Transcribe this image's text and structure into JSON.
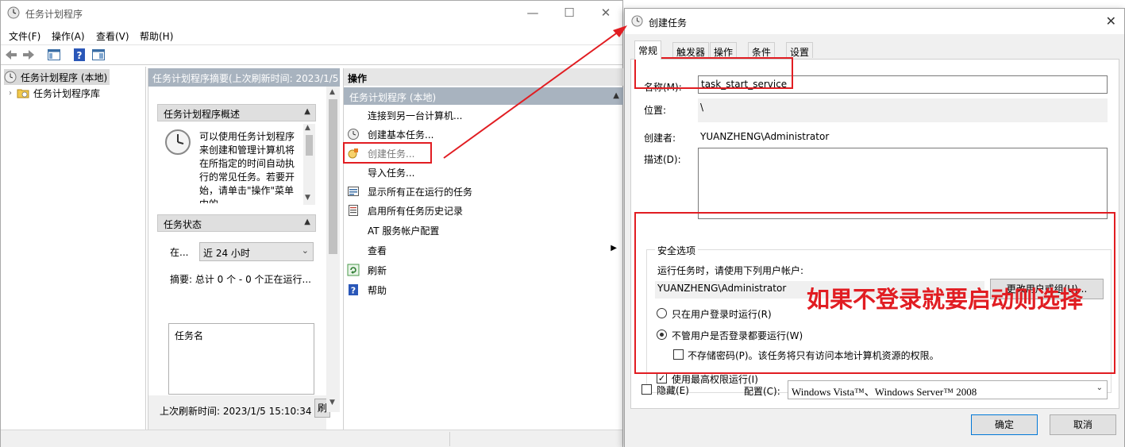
{
  "main_window": {
    "title": "任务计划程序",
    "menu": [
      "文件(F)",
      "操作(A)",
      "查看(V)",
      "帮助(H)"
    ],
    "tree": [
      "任务计划程序 (本地)",
      "任务计划程序库"
    ],
    "center": {
      "header": "任务计划程序摘要(上次刷新时间: 2023/1/5",
      "overview_title": "任务计划程序概述",
      "overview_text": "可以使用任务计划程序来创建和管理计算机将在所指定的时间自动执行的常见任务。若要开始，请单击\"操作\"菜单中的",
      "status_title": "任务状态",
      "status_prefix": "在...",
      "status_select": "近 24 小时",
      "summary": "摘要: 总计 0 个 - 0 个正在运行...",
      "task_col": "任务名",
      "last_refresh": "上次刷新时间: 2023/1/5 15:10:34",
      "refresh_btn": "刷"
    },
    "actions": {
      "header": "操作",
      "sub_header": "任务计划程序 (本地)",
      "items": [
        {
          "label": "连接到另一台计算机...",
          "icon": "none"
        },
        {
          "label": "创建基本任务...",
          "icon": "clock-wizard-icon"
        },
        {
          "label": "创建任务...",
          "icon": "create-task-icon"
        },
        {
          "label": "导入任务...",
          "icon": "none"
        },
        {
          "label": "显示所有正在运行的任务",
          "icon": "running-tasks-icon"
        },
        {
          "label": "启用所有任务历史记录",
          "icon": "history-icon"
        },
        {
          "label": "AT 服务帐户配置",
          "icon": "none"
        },
        {
          "label": "查看",
          "icon": "none"
        },
        {
          "label": "刷新",
          "icon": "refresh-icon"
        },
        {
          "label": "帮助",
          "icon": "help-icon"
        }
      ]
    }
  },
  "dialog": {
    "title": "创建任务",
    "tabs": [
      "常规",
      "触发器",
      "操作",
      "条件",
      "设置"
    ],
    "name_label": "名称(M):",
    "name_value": "task_start_service",
    "location_label": "位置:",
    "location_value": "\\",
    "author_label": "创建者:",
    "author_value": "YUANZHENG\\Administrator",
    "description_label": "描述(D):",
    "security": {
      "title": "安全选项",
      "run_as_label": "运行任务时，请使用下列用户帐户:",
      "run_as_value": "YUANZHENG\\Administrator",
      "change_user_button": "更改用户或组(U)...",
      "radio_logged_on": "只在用户登录时运行(R)",
      "radio_whether": "不管用户是否登录都要运行(W)",
      "no_store_password": "不存储密码(P)。该任务将只有访问本地计算机资源的权限。",
      "highest_privileges": "使用最高权限运行(I)"
    },
    "hidden_label": "隐藏(E)",
    "config_label": "配置(C):",
    "config_value": "Windows Vista™、Windows Server™ 2008",
    "ok_button": "确定",
    "cancel_button": "取消"
  },
  "annotation": {
    "text": "如果不登录就要启动则选择",
    "color": "#e11d22"
  }
}
